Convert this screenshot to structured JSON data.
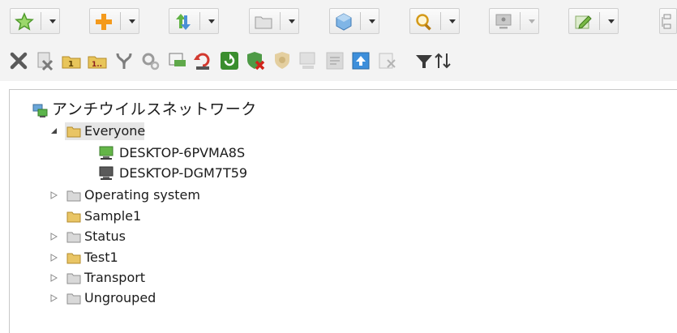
{
  "toolbar_top": {
    "groups": [
      {
        "icon": "star-icon"
      },
      {
        "icon": "plus-icon"
      },
      {
        "icon": "arrows-icon"
      },
      {
        "icon": "folder-icon"
      },
      {
        "icon": "cube-icon"
      },
      {
        "icon": "magnifier-icon"
      },
      {
        "icon": "monitor-disabled-icon"
      },
      {
        "icon": "edit-icon"
      },
      {
        "icon": "hierarchy-icon"
      }
    ]
  },
  "toolbar_actions": [
    "delete-icon",
    "delete-task-icon",
    "rename-icon",
    "rename-first-icon",
    "merge-icon",
    "settings-icon",
    "report-icon",
    "undo-icon",
    "refresh-icon",
    "remove-protection-icon",
    "shield-disabled-icon",
    "search-disabled-icon",
    "sync-disabled-icon",
    "upload-icon",
    "export-disabled-icon",
    "filter-icon",
    "sort-icon"
  ],
  "tree": {
    "root": {
      "label": "アンチウイルスネットワーク"
    },
    "everyone": {
      "label": "Everyone"
    },
    "computers": [
      {
        "label": "DESKTOP-6PVMA8S",
        "status": "online"
      },
      {
        "label": "DESKTOP-DGM7T59",
        "status": "offline"
      }
    ],
    "groups": [
      {
        "label": "Operating system",
        "expandable": true,
        "color": "gray"
      },
      {
        "label": "Sample1",
        "expandable": false,
        "color": "yellow"
      },
      {
        "label": "Status",
        "expandable": true,
        "color": "gray"
      },
      {
        "label": "Test1",
        "expandable": true,
        "color": "yellow"
      },
      {
        "label": "Transport",
        "expandable": true,
        "color": "gray"
      },
      {
        "label": "Ungrouped",
        "expandable": true,
        "color": "gray"
      }
    ]
  }
}
